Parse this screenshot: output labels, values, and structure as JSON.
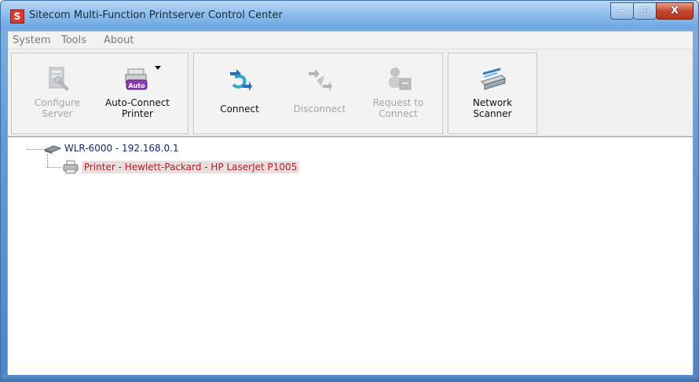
{
  "window": {
    "title": "Sitecom Multi-Function Printserver Control Center",
    "icon_letter": "S",
    "controls": {
      "minimize": "–",
      "maximize": "▢",
      "close": "X"
    }
  },
  "menu": {
    "items": [
      {
        "label": "System"
      },
      {
        "label": "Tools"
      },
      {
        "label": "About"
      }
    ]
  },
  "toolbar": {
    "configure_server": {
      "label_line1": "Configure",
      "label_line2": "Server",
      "icon": "configure-server-icon",
      "enabled": false
    },
    "auto_connect_printer": {
      "label_line1": "Auto-Connect",
      "label_line2": "Printer",
      "icon": "auto-connect-printer-icon",
      "icon_badge": "Auto",
      "enabled": true
    },
    "connect": {
      "label_line1": "Connect",
      "icon": "connect-icon",
      "enabled": true
    },
    "disconnect": {
      "label_line1": "Disconnect",
      "icon": "disconnect-icon",
      "enabled": false
    },
    "request_to_connect": {
      "label_line1": "Request to",
      "label_line2": "Connect",
      "icon": "request-to-connect-icon",
      "enabled": false
    },
    "network_scanner": {
      "label_line1": "Network",
      "label_line2": "Scanner",
      "icon": "network-scanner-icon",
      "enabled": true
    }
  },
  "tree": {
    "root": {
      "label": "WLR-6000 - 192.168.0.1",
      "icon": "router-icon"
    },
    "children": [
      {
        "label": "Printer - Hewlett-Packard - HP LaserJet P1005",
        "icon": "printer-icon",
        "selected": true
      }
    ]
  },
  "colors": {
    "selected_text": "#b0202a",
    "root_text": "#102a6b",
    "disabled_text": "#a6a6a6"
  }
}
